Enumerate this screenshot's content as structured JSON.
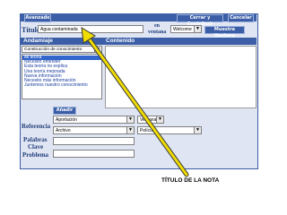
{
  "colors": {
    "frame": "#3b5ea6",
    "panel": "#dfe5f2",
    "label": "#1f3c7a",
    "arrow": "#e8d400"
  },
  "toolbar": {
    "advanced_label": "Avanzado",
    "close_contrib_label": "Cerrar y Contribuir",
    "cancel_label": "Cancelar"
  },
  "title_row": {
    "title_label": "Título",
    "title_value": "Agua contaminada",
    "in_windows_label_top": "en",
    "in_windows_label_bottom": "ventana",
    "window_select_value": "Welcome",
    "show_window_label": "Muestra Ventana"
  },
  "scaffold": {
    "header": "Andamiaje",
    "select_value": "Construcción de conocimiento",
    "items": [
      "Mi teoría",
      "Necesito entender",
      "Esta teoría no explica",
      "Una teoría mejorada",
      "Nueva información",
      "Necesito más información",
      "Juntemos nuestro conocimiento"
    ]
  },
  "content": {
    "header": "Contenido"
  },
  "add_label": "Añadir",
  "references": {
    "label": "Referencia",
    "row1_left": "Aportación",
    "row1_right": "Ventana",
    "row2_left": "Archivo",
    "row2_right": "Película"
  },
  "keywords_label_top": "Palabras",
  "keywords_label_bottom": "Clave",
  "problem_label": "Problema",
  "annotation": "TÍTULO DE LA NOTA"
}
